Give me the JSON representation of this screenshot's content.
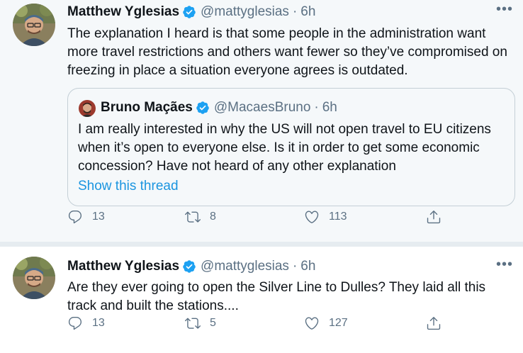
{
  "tweets": [
    {
      "name": "Matthew Yglesias",
      "handle": "@mattyglesias",
      "separator": "·",
      "time": "6h",
      "more": "•••",
      "text": "The explanation I heard is that some people in the administration want more travel restrictions and others want fewer so they’ve compromised on freezing in place a situation everyone agrees is outdated.",
      "quote": {
        "name": "Bruno Maçães",
        "handle": "@MacaesBruno",
        "separator": "·",
        "time": "6h",
        "text": "I am really interested in why the US will not open travel to EU citizens when it’s open to everyone else. Is it in order to get some economic concession? Have not heard of any other explanation",
        "link": "Show this thread"
      },
      "replies": "13",
      "retweets": "8",
      "likes": "113"
    },
    {
      "name": "Matthew Yglesias",
      "handle": "@mattyglesias",
      "separator": "·",
      "time": "6h",
      "more": "•••",
      "text": "Are they ever going to open the Silver Line to Dulles? They laid all this track and built the stations....",
      "replies": "13",
      "retweets": "5",
      "likes": "127"
    }
  ],
  "icons": {
    "verified": "verified-badge-icon",
    "reply": "reply-icon",
    "retweet": "retweet-icon",
    "like": "heart-icon",
    "share": "share-icon"
  },
  "colors": {
    "verified": "#1da1f2",
    "link": "#1b95e0",
    "muted": "#5b7083"
  }
}
